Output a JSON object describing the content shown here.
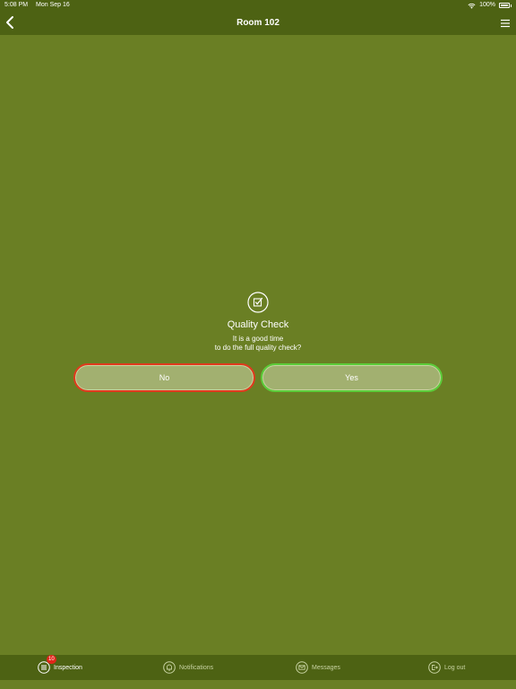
{
  "status_bar": {
    "time": "5:08 PM",
    "date": "Mon Sep 16",
    "battery": "100%",
    "wifi_icon": "wifi-icon",
    "battery_icon": "battery-icon"
  },
  "nav": {
    "title": "Room 102",
    "back_icon": "chevron-left-icon",
    "menu_icon": "hamburger-menu-icon"
  },
  "dialog": {
    "icon": "checkbox-edit-icon",
    "title": "Quality Check",
    "message_line1": "It is a good time",
    "message_line2": "to do the full quality check?",
    "no_label": "No",
    "yes_label": "Yes"
  },
  "tabs": [
    {
      "label": "Inspection",
      "icon": "list-icon",
      "badge": "10",
      "active": true
    },
    {
      "label": "Notifications",
      "icon": "bell-icon",
      "active": false
    },
    {
      "label": "Messages",
      "icon": "mail-icon",
      "active": false
    },
    {
      "label": "Log out",
      "icon": "logout-icon",
      "active": false
    }
  ],
  "colors": {
    "background": "#6a7f24",
    "bar": "#4d6213",
    "no_border": "#e03a1e",
    "yes_border": "#5ccc3a",
    "button_fill": "#a2b070",
    "badge": "#e0261a"
  }
}
